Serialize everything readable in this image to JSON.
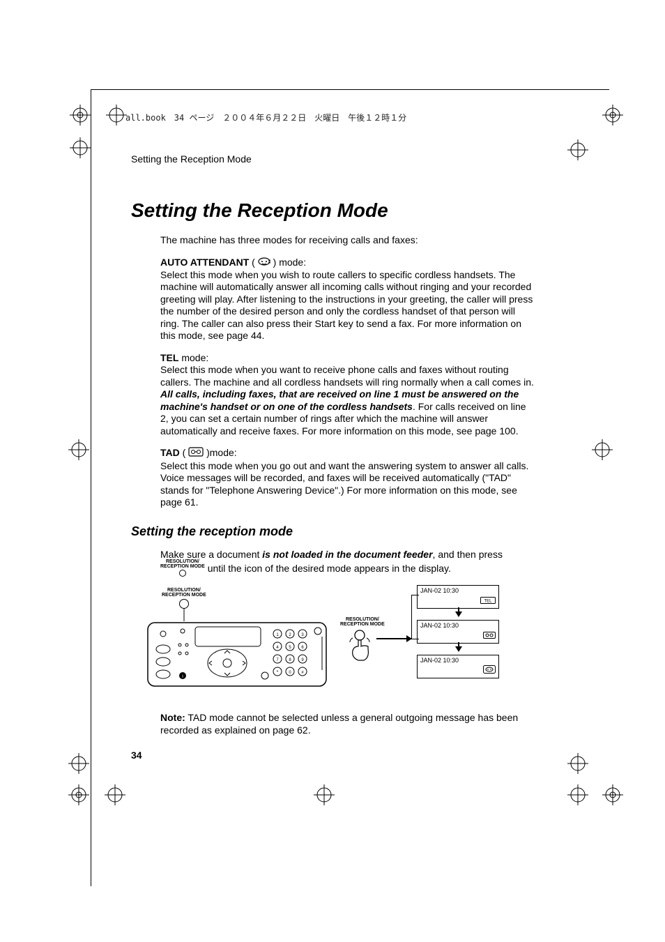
{
  "header_text": "all.book　34 ページ　２００４年６月２２日　火曜日　午後１２時１分",
  "page_header": "Setting the Reception Mode",
  "title": "Setting the Reception Mode",
  "intro": "The machine has three modes for receiving calls and faxes:",
  "auto": {
    "label": "AUTO ATTENDANT",
    "suffix_before_icon": " ( ",
    "suffix_after_icon": " ) mode:",
    "desc": "Select this mode when you wish to route callers to specific cordless handsets. The machine will automatically answer all incoming calls without ringing and your recorded greeting will play. After listening to the instructions in your greeting, the caller will press the number of the desired person and only the cordless handset of that person will ring. The caller can also press their Start key to send a fax. For more information on this mode, see page 44."
  },
  "tel": {
    "label": "TEL",
    "suffix": " mode:",
    "desc_a": "Select this mode when you want to receive phone calls and faxes without routing callers. The machine and all cordless handsets will ring normally when a call comes in. ",
    "desc_emph": "All calls, including faxes, that are received on line 1 must be answered on the machine's handset or on one of the cordless handsets",
    "desc_b": ".  For calls received on line 2, you can set a certain number of rings after which the machine will answer automatically and receive faxes. For more information on this mode, see page 100."
  },
  "tad": {
    "label": "TAD",
    "suffix_before_icon": " ( ",
    "suffix_after_icon": " )mode:",
    "desc": "Select this mode when you go out and want the answering system to answer all calls. Voice messages will be recorded, and faxes will be received automatically (\"TAD\" stands for \"Telephone Answering Device\".) For more information on this mode, see page 61."
  },
  "subtitle": "Setting the reception mode",
  "instr": {
    "a": "Make sure a document ",
    "emph": "is not loaded in the document feeder",
    "b": ", and then press ",
    "c": " until the icon of the desired mode appears in the display."
  },
  "keylabel": {
    "line1": "RESOLUTION/",
    "line2": "RECEPTION MODE"
  },
  "displays": {
    "t": "JAN-02 10:30"
  },
  "note": {
    "label": "Note:",
    "text": " TAD mode cannot be selected unless a general outgoing message has been recorded as explained on page 62."
  },
  "page_number": "34"
}
